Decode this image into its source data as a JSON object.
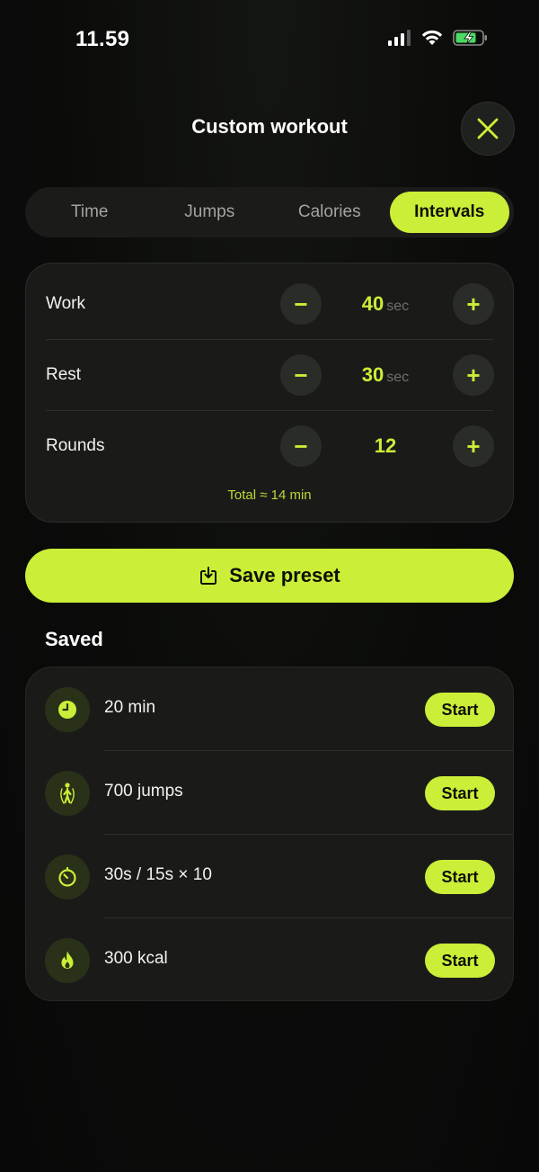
{
  "status_bar": {
    "time": "11.59"
  },
  "header": {
    "title": "Custom workout"
  },
  "tabs": [
    {
      "label": "Time",
      "active": false
    },
    {
      "label": "Jumps",
      "active": false
    },
    {
      "label": "Calories",
      "active": false
    },
    {
      "label": "Intervals",
      "active": true
    }
  ],
  "intervals": {
    "work": {
      "label": "Work",
      "value": "40",
      "unit": "sec"
    },
    "rest": {
      "label": "Rest",
      "value": "30",
      "unit": "sec"
    },
    "rounds": {
      "label": "Rounds",
      "value": "12"
    },
    "total": "Total ≈ 14 min"
  },
  "stepper": {
    "minus": "−",
    "plus": "+"
  },
  "save_button": {
    "label": "Save preset"
  },
  "saved": {
    "title": "Saved",
    "start_label": "Start",
    "items": [
      {
        "label": "20 min",
        "icon": "clock-icon"
      },
      {
        "label": "700 jumps",
        "icon": "jumping-person-icon"
      },
      {
        "label": "30s / 15s × 10",
        "icon": "timer-icon"
      },
      {
        "label": "300 kcal",
        "icon": "flame-icon"
      }
    ]
  },
  "colors": {
    "accent": "#cbee38",
    "background": "#0b0c0a",
    "card": "#1a1b19"
  }
}
